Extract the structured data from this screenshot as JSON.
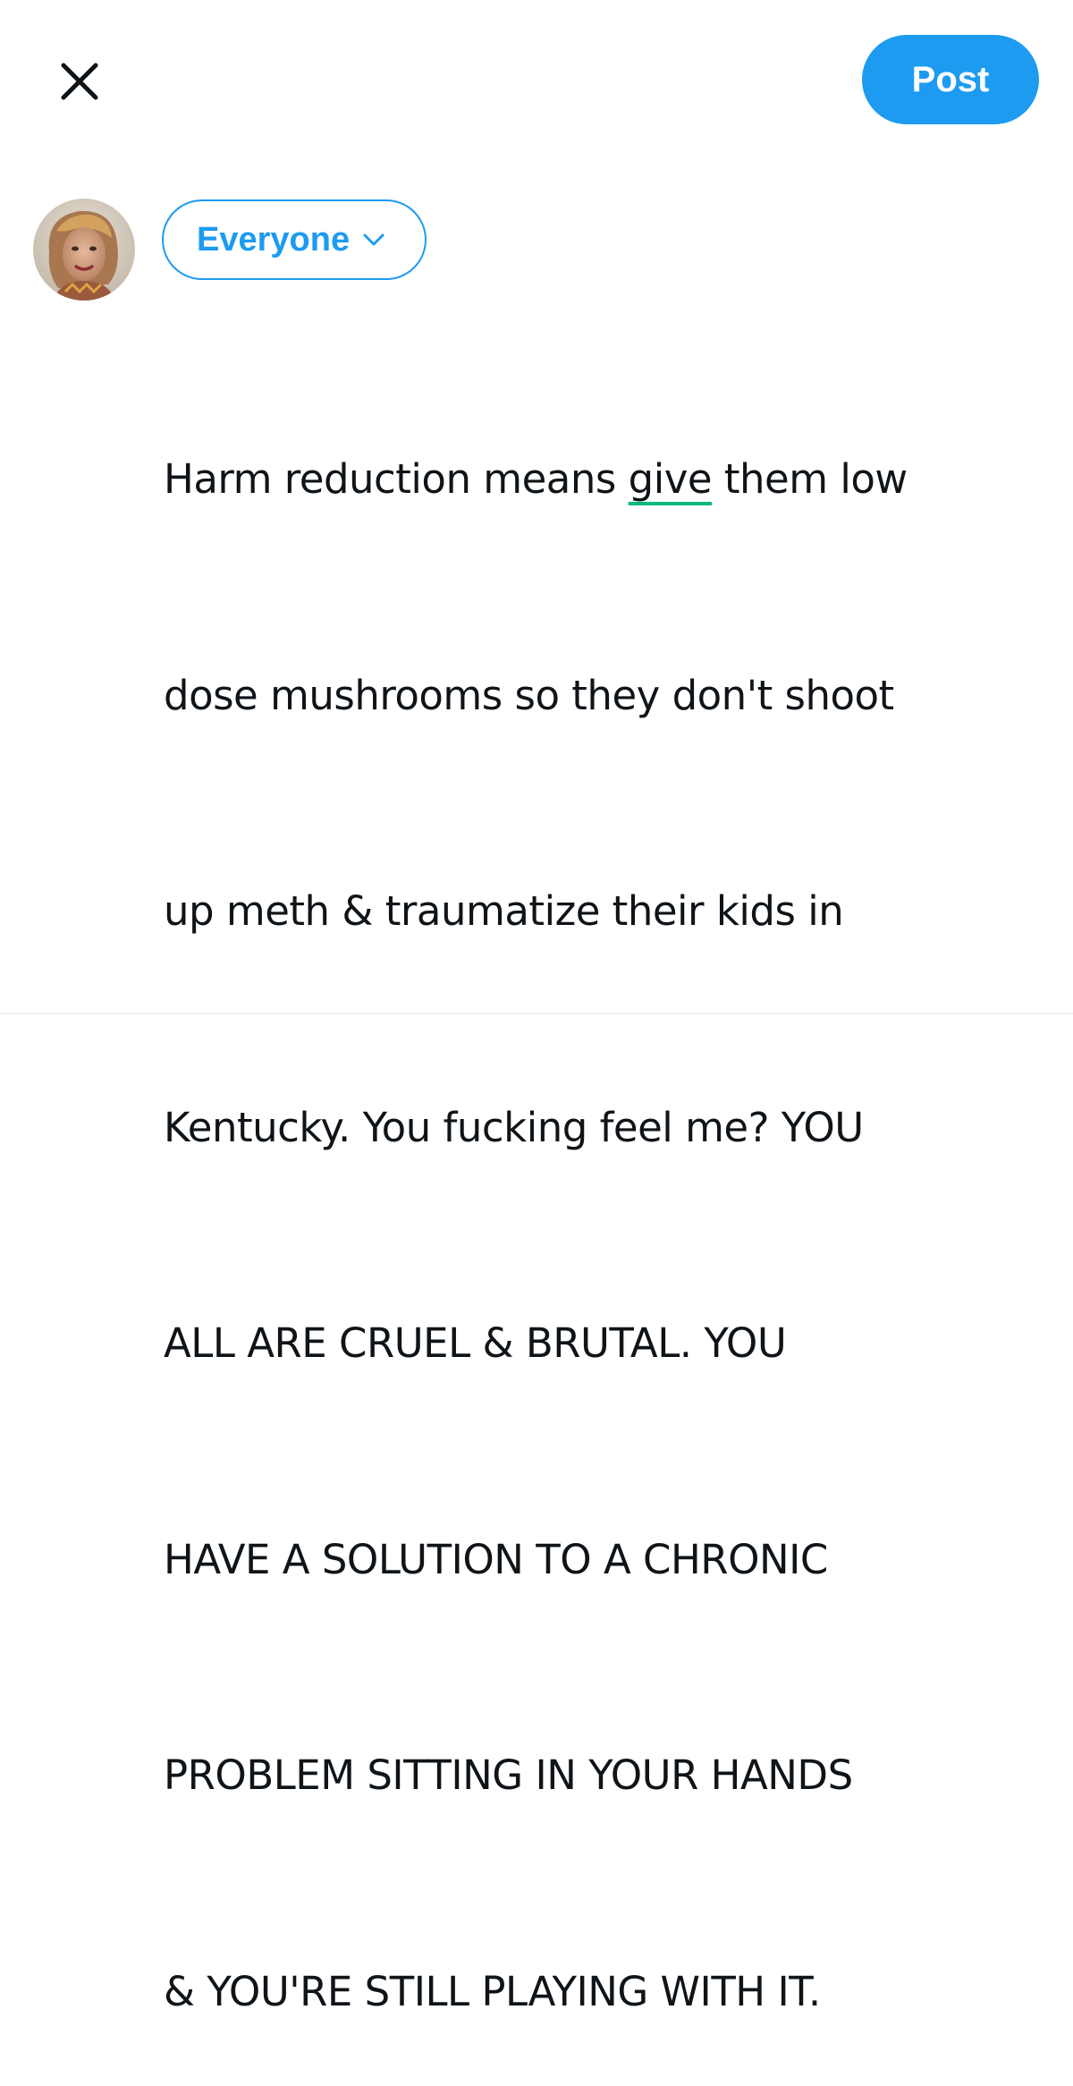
{
  "header": {
    "close_icon": "close-icon",
    "post_label": "Post",
    "accent_color": "#1d9bf0"
  },
  "composer": {
    "audience_label": "Everyone",
    "audience_icon": "chevron-down-icon",
    "text_lines": [
      {
        "before": "Harm reduction means ",
        "flagged": "give",
        "after": " them low"
      },
      {
        "text": "dose mushrooms so they don't shoot"
      },
      {
        "text": "up meth & traumatize their kids in"
      },
      {
        "text": "Kentucky. You fucking feel me? YOU"
      },
      {
        "text": "ALL ARE CRUEL & BRUTAL. YOU"
      },
      {
        "text": "HAVE A SOLUTION TO A CHRONIC"
      },
      {
        "text": "PROBLEM SITTING IN YOUR HANDS"
      },
      {
        "text": "& YOU'RE STILL PLAYING WITH IT."
      }
    ],
    "spellcheck_color": "#00ba7c"
  }
}
